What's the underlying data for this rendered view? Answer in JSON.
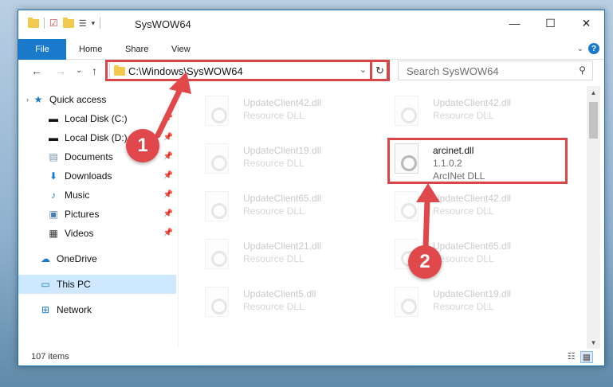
{
  "window": {
    "title": "SysWOW64",
    "controls": {
      "minimize": "—",
      "maximize": "☐",
      "close": "✕"
    }
  },
  "ribbon": {
    "tabs": [
      "File",
      "Home",
      "Share",
      "View"
    ],
    "help": "?"
  },
  "nav": {
    "back": "←",
    "forward": "→",
    "recent": "⌄",
    "up": "↑",
    "address": "C:\\Windows\\SysWOW64",
    "address_dropdown": "⌄",
    "refresh": "↻",
    "search_placeholder": "Search SysWOW64"
  },
  "sidebar": {
    "items": [
      {
        "label": "Quick access",
        "icon": "star-icon",
        "pinned": false
      },
      {
        "label": "Local Disk (C:)",
        "icon": "drive-icon",
        "pinned": true
      },
      {
        "label": "Local Disk (D:)",
        "icon": "drive-icon",
        "pinned": true
      },
      {
        "label": "Documents",
        "icon": "documents-icon",
        "pinned": true
      },
      {
        "label": "Downloads",
        "icon": "download-icon",
        "pinned": true
      },
      {
        "label": "Music",
        "icon": "music-icon",
        "pinned": true
      },
      {
        "label": "Pictures",
        "icon": "pictures-icon",
        "pinned": true
      },
      {
        "label": "Videos",
        "icon": "videos-icon",
        "pinned": true
      },
      {
        "label": "OneDrive",
        "icon": "cloud-icon",
        "pinned": false
      },
      {
        "label": "This PC",
        "icon": "computer-icon",
        "pinned": false,
        "selected": true
      },
      {
        "label": "Network",
        "icon": "network-icon",
        "pinned": false
      }
    ]
  },
  "files": [
    {
      "name": "UpdateClient42.dll",
      "desc": "Resource DLL",
      "ghost": true
    },
    {
      "name": "UpdateClient42.dll",
      "desc": "Resource DLL",
      "ghost": true
    },
    {
      "name": "UpdateClient19.dll",
      "desc": "Resource DLL",
      "ghost": true
    },
    {
      "name": "arcinet.dll",
      "desc": "1.1.0.2",
      "desc2": "ArcINet DLL",
      "ghost": false
    },
    {
      "name": "UpdateClient65.dll",
      "desc": "Resource DLL",
      "ghost": true
    },
    {
      "name": "UpdateClient42.dll",
      "desc": "Resource DLL",
      "ghost": true
    },
    {
      "name": "UpdateClient21.dll",
      "desc": "Resource DLL",
      "ghost": true
    },
    {
      "name": "UpdateClient65.dll",
      "desc": "Resource DLL",
      "ghost": true
    },
    {
      "name": "UpdateClient5.dll",
      "desc": "Resource DLL",
      "ghost": true
    },
    {
      "name": "UpdateClient19.dll",
      "desc": "Resource DLL",
      "ghost": true
    }
  ],
  "status": {
    "count": "107 items"
  },
  "callouts": {
    "step1": "1",
    "step2": "2"
  },
  "colors": {
    "accent": "#1979ca",
    "highlight": "#d9464a",
    "selected": "#cde8ff"
  }
}
